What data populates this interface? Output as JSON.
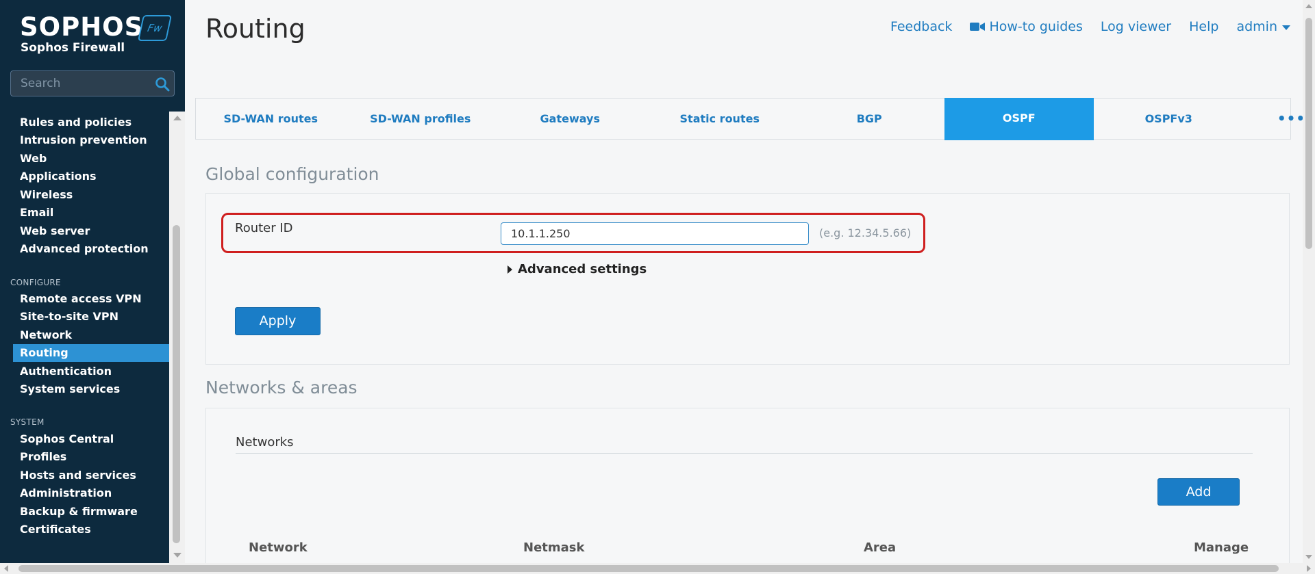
{
  "brand": {
    "logo_text": "SOPHOS",
    "logo_badge": "Fw",
    "product_name": "Sophos Firewall",
    "accent_color": "#2d92d4"
  },
  "search": {
    "placeholder": "Search",
    "icon": "search-icon"
  },
  "nav": {
    "protect_items": [
      "Rules and policies",
      "Intrusion prevention",
      "Web",
      "Applications",
      "Wireless",
      "Email",
      "Web server",
      "Advanced protection"
    ],
    "configure_header": "CONFIGURE",
    "configure_items": [
      "Remote access VPN",
      "Site-to-site VPN",
      "Network",
      "Routing",
      "Authentication",
      "System services"
    ],
    "system_header": "SYSTEM",
    "system_items": [
      "Sophos Central",
      "Profiles",
      "Hosts and services",
      "Administration",
      "Backup & firmware",
      "Certificates"
    ],
    "active_item": "Routing"
  },
  "header": {
    "title": "Routing",
    "links": {
      "feedback": "Feedback",
      "howto": "How-to guides",
      "logviewer": "Log viewer",
      "help": "Help",
      "user": "admin"
    }
  },
  "tabs": {
    "items": [
      "SD-WAN routes",
      "SD-WAN profiles",
      "Gateways",
      "Static routes",
      "BGP",
      "OSPF",
      "OSPFv3"
    ],
    "active": "OSPF",
    "more_icon": "more-horizontal-icon",
    "more_label": "•••"
  },
  "global_config": {
    "title": "Global configuration",
    "router_id_label": "Router ID",
    "router_id_value": "10.1.1.250",
    "router_id_hint": "(e.g. 12.34.5.66)",
    "advanced_settings": "Advanced settings",
    "apply_label": "Apply"
  },
  "networks_areas": {
    "title": "Networks & areas",
    "networks_label": "Networks",
    "add_label": "Add",
    "columns": [
      "Network",
      "Netmask",
      "Area",
      "Manage"
    ]
  }
}
